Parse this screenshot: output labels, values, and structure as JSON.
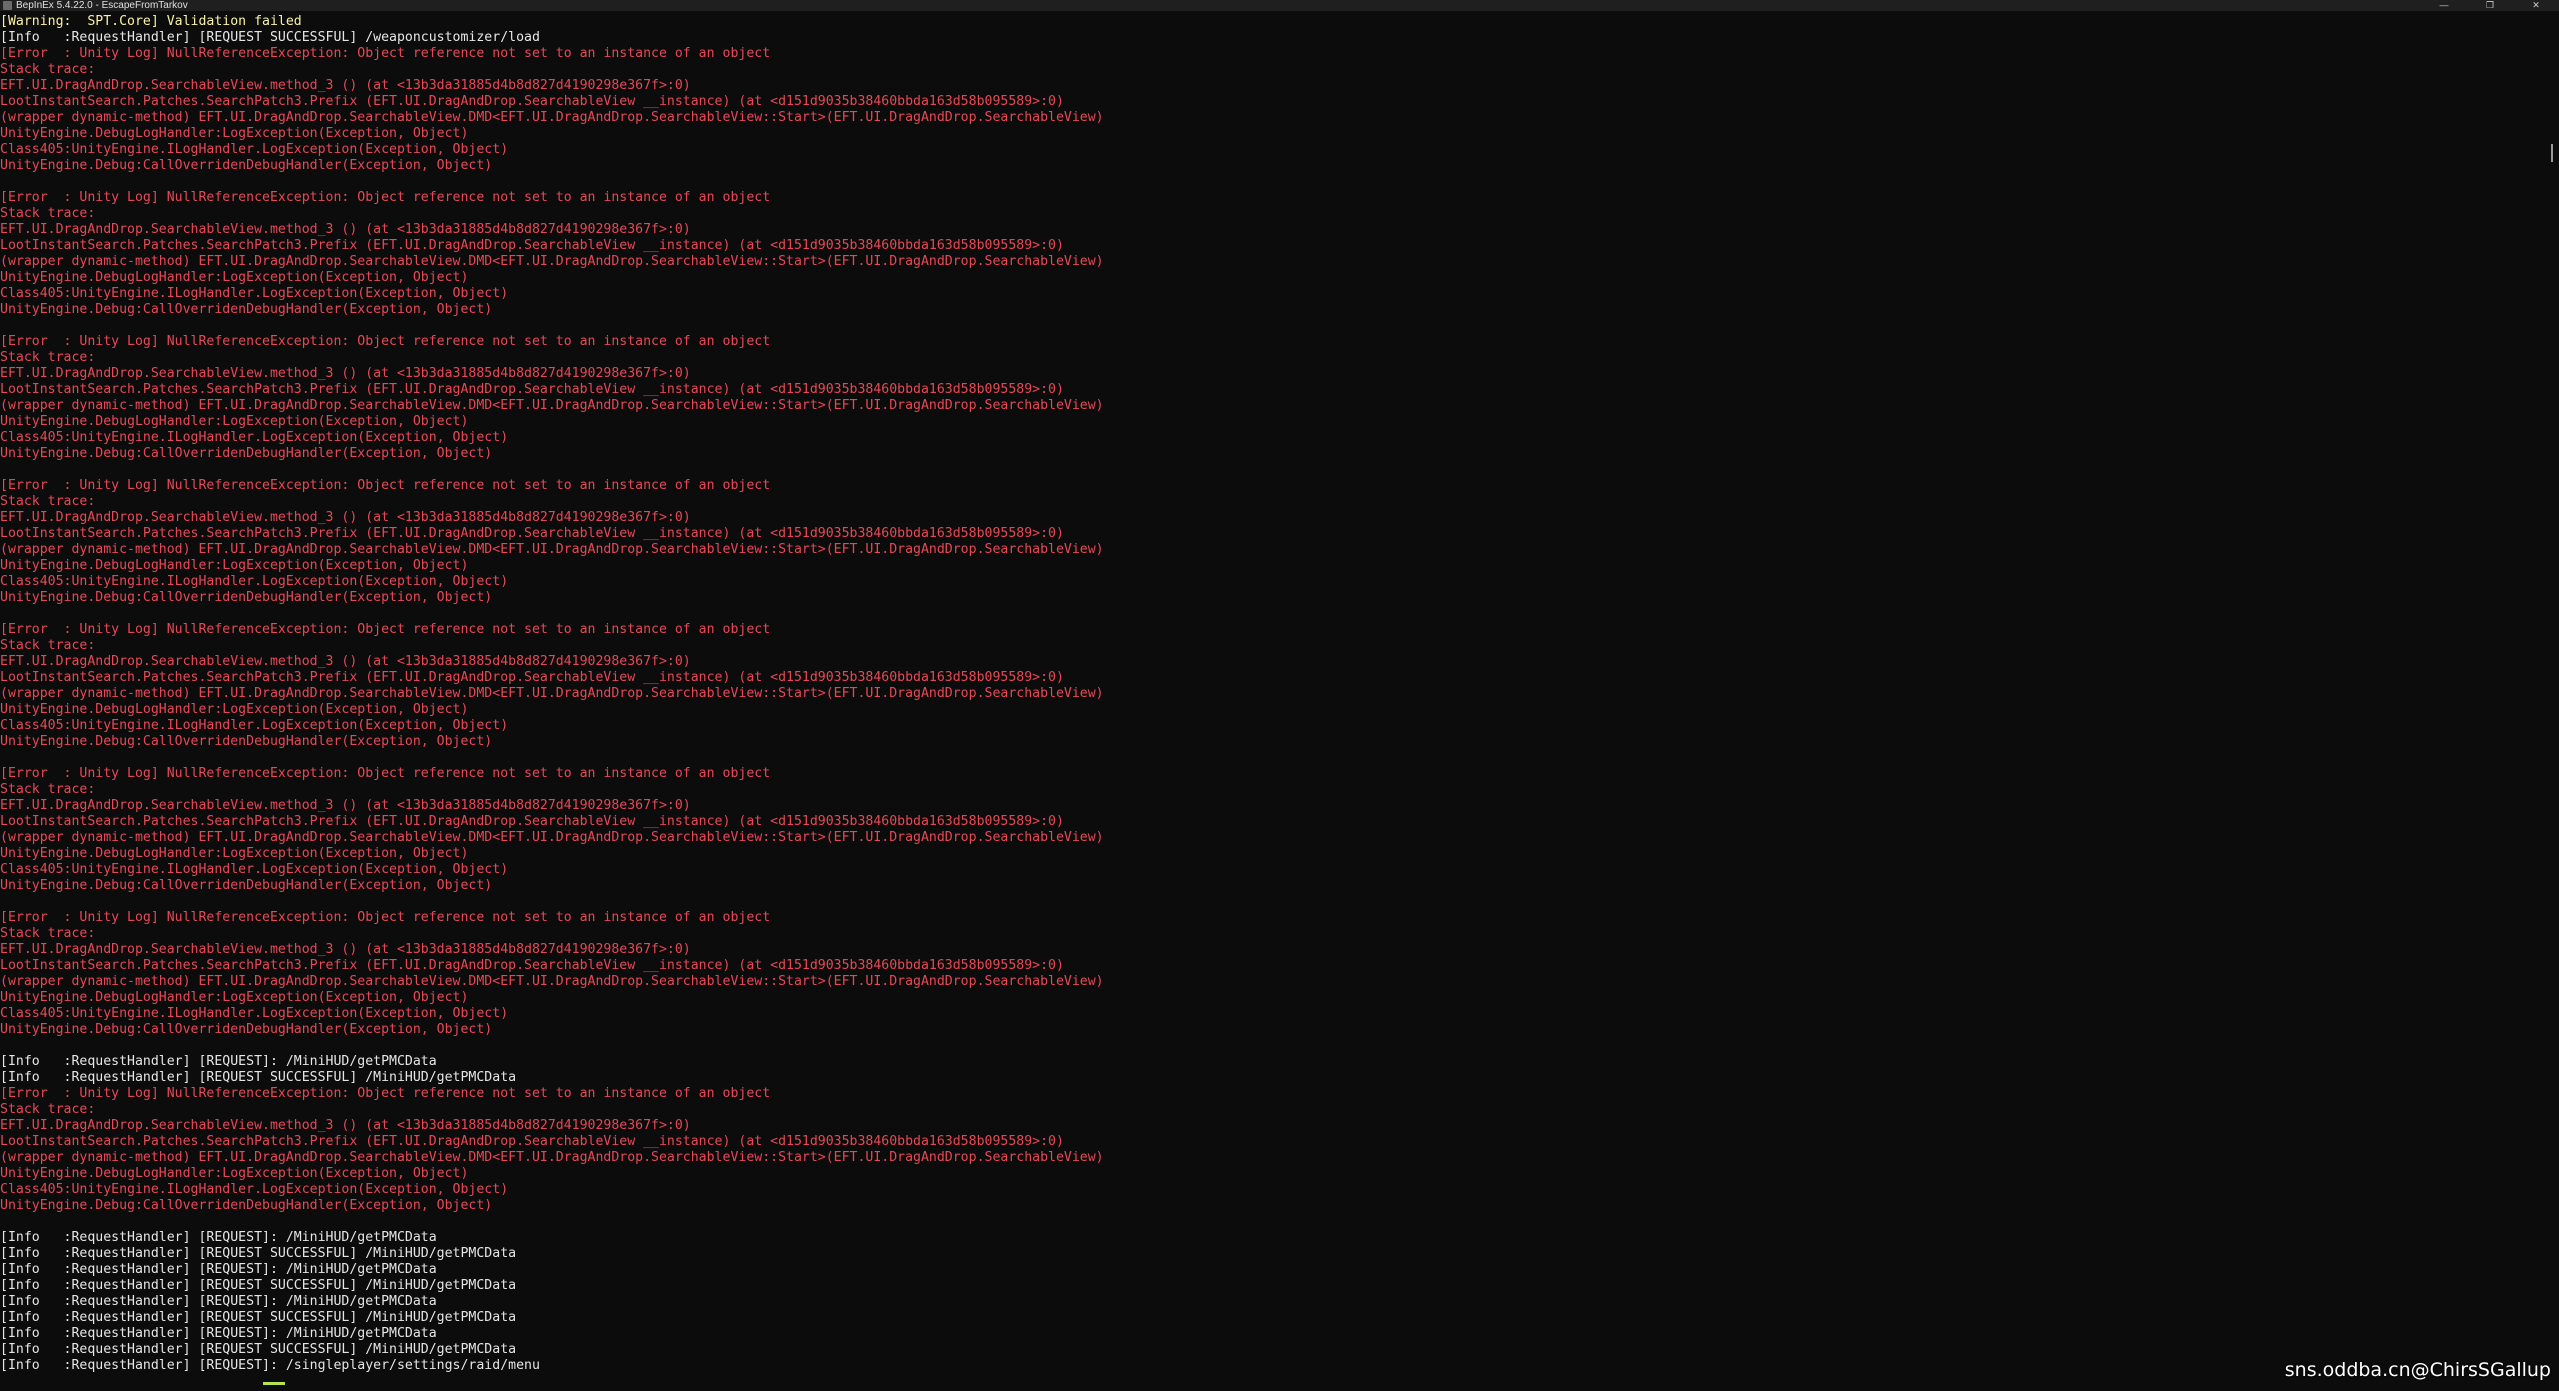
{
  "window": {
    "title": "BepInEx 5.4.22.0 - EscapeFromTarkov",
    "app_icon": "bepinex-icon",
    "minimize_glyph": "—",
    "maximize_glyph": "❐",
    "close_glyph": "✕"
  },
  "colors": {
    "background": "#0c0c0c",
    "error": "#e74856",
    "warning": "#f9f1a5",
    "info": "#e6e6e6",
    "cursor": "#b6e24e"
  },
  "console_lines": [
    {
      "type": "warning",
      "text": "[Warning:  SPT.Core] Validation failed"
    },
    {
      "type": "info",
      "text": "[Info   :RequestHandler] [REQUEST SUCCESSFUL] /weaponcustomizer/load"
    },
    {
      "type": "error",
      "text": "[Error  : Unity Log] NullReferenceException: Object reference not set to an instance of an object"
    },
    {
      "type": "error",
      "text": "Stack trace:"
    },
    {
      "type": "error",
      "text": "EFT.UI.DragAndDrop.SearchableView.method_3 () (at <13b3da31885d4b8d827d4190298e367f>:0)"
    },
    {
      "type": "error",
      "text": "LootInstantSearch.Patches.SearchPatch3.Prefix (EFT.UI.DragAndDrop.SearchableView __instance) (at <d151d9035b38460bbda163d58b095589>:0)"
    },
    {
      "type": "error",
      "text": "(wrapper dynamic-method) EFT.UI.DragAndDrop.SearchableView.DMD<EFT.UI.DragAndDrop.SearchableView::Start>(EFT.UI.DragAndDrop.SearchableView)"
    },
    {
      "type": "error",
      "text": "UnityEngine.DebugLogHandler:LogException(Exception, Object)"
    },
    {
      "type": "error",
      "text": "Class405:UnityEngine.ILogHandler.LogException(Exception, Object)"
    },
    {
      "type": "error",
      "text": "UnityEngine.Debug:CallOverridenDebugHandler(Exception, Object)"
    },
    {
      "type": "blank",
      "text": ""
    },
    {
      "type": "error",
      "text": "[Error  : Unity Log] NullReferenceException: Object reference not set to an instance of an object"
    },
    {
      "type": "error",
      "text": "Stack trace:"
    },
    {
      "type": "error",
      "text": "EFT.UI.DragAndDrop.SearchableView.method_3 () (at <13b3da31885d4b8d827d4190298e367f>:0)"
    },
    {
      "type": "error",
      "text": "LootInstantSearch.Patches.SearchPatch3.Prefix (EFT.UI.DragAndDrop.SearchableView __instance) (at <d151d9035b38460bbda163d58b095589>:0)"
    },
    {
      "type": "error",
      "text": "(wrapper dynamic-method) EFT.UI.DragAndDrop.SearchableView.DMD<EFT.UI.DragAndDrop.SearchableView::Start>(EFT.UI.DragAndDrop.SearchableView)"
    },
    {
      "type": "error",
      "text": "UnityEngine.DebugLogHandler:LogException(Exception, Object)"
    },
    {
      "type": "error",
      "text": "Class405:UnityEngine.ILogHandler.LogException(Exception, Object)"
    },
    {
      "type": "error",
      "text": "UnityEngine.Debug:CallOverridenDebugHandler(Exception, Object)"
    },
    {
      "type": "blank",
      "text": ""
    },
    {
      "type": "error",
      "text": "[Error  : Unity Log] NullReferenceException: Object reference not set to an instance of an object"
    },
    {
      "type": "error",
      "text": "Stack trace:"
    },
    {
      "type": "error",
      "text": "EFT.UI.DragAndDrop.SearchableView.method_3 () (at <13b3da31885d4b8d827d4190298e367f>:0)"
    },
    {
      "type": "error",
      "text": "LootInstantSearch.Patches.SearchPatch3.Prefix (EFT.UI.DragAndDrop.SearchableView __instance) (at <d151d9035b38460bbda163d58b095589>:0)"
    },
    {
      "type": "error",
      "text": "(wrapper dynamic-method) EFT.UI.DragAndDrop.SearchableView.DMD<EFT.UI.DragAndDrop.SearchableView::Start>(EFT.UI.DragAndDrop.SearchableView)"
    },
    {
      "type": "error",
      "text": "UnityEngine.DebugLogHandler:LogException(Exception, Object)"
    },
    {
      "type": "error",
      "text": "Class405:UnityEngine.ILogHandler.LogException(Exception, Object)"
    },
    {
      "type": "error",
      "text": "UnityEngine.Debug:CallOverridenDebugHandler(Exception, Object)"
    },
    {
      "type": "blank",
      "text": ""
    },
    {
      "type": "error",
      "text": "[Error  : Unity Log] NullReferenceException: Object reference not set to an instance of an object"
    },
    {
      "type": "error",
      "text": "Stack trace:"
    },
    {
      "type": "error",
      "text": "EFT.UI.DragAndDrop.SearchableView.method_3 () (at <13b3da31885d4b8d827d4190298e367f>:0)"
    },
    {
      "type": "error",
      "text": "LootInstantSearch.Patches.SearchPatch3.Prefix (EFT.UI.DragAndDrop.SearchableView __instance) (at <d151d9035b38460bbda163d58b095589>:0)"
    },
    {
      "type": "error",
      "text": "(wrapper dynamic-method) EFT.UI.DragAndDrop.SearchableView.DMD<EFT.UI.DragAndDrop.SearchableView::Start>(EFT.UI.DragAndDrop.SearchableView)"
    },
    {
      "type": "error",
      "text": "UnityEngine.DebugLogHandler:LogException(Exception, Object)"
    },
    {
      "type": "error",
      "text": "Class405:UnityEngine.ILogHandler.LogException(Exception, Object)"
    },
    {
      "type": "error",
      "text": "UnityEngine.Debug:CallOverridenDebugHandler(Exception, Object)"
    },
    {
      "type": "blank",
      "text": ""
    },
    {
      "type": "error",
      "text": "[Error  : Unity Log] NullReferenceException: Object reference not set to an instance of an object"
    },
    {
      "type": "error",
      "text": "Stack trace:"
    },
    {
      "type": "error",
      "text": "EFT.UI.DragAndDrop.SearchableView.method_3 () (at <13b3da31885d4b8d827d4190298e367f>:0)"
    },
    {
      "type": "error",
      "text": "LootInstantSearch.Patches.SearchPatch3.Prefix (EFT.UI.DragAndDrop.SearchableView __instance) (at <d151d9035b38460bbda163d58b095589>:0)"
    },
    {
      "type": "error",
      "text": "(wrapper dynamic-method) EFT.UI.DragAndDrop.SearchableView.DMD<EFT.UI.DragAndDrop.SearchableView::Start>(EFT.UI.DragAndDrop.SearchableView)"
    },
    {
      "type": "error",
      "text": "UnityEngine.DebugLogHandler:LogException(Exception, Object)"
    },
    {
      "type": "error",
      "text": "Class405:UnityEngine.ILogHandler.LogException(Exception, Object)"
    },
    {
      "type": "error",
      "text": "UnityEngine.Debug:CallOverridenDebugHandler(Exception, Object)"
    },
    {
      "type": "blank",
      "text": ""
    },
    {
      "type": "error",
      "text": "[Error  : Unity Log] NullReferenceException: Object reference not set to an instance of an object"
    },
    {
      "type": "error",
      "text": "Stack trace:"
    },
    {
      "type": "error",
      "text": "EFT.UI.DragAndDrop.SearchableView.method_3 () (at <13b3da31885d4b8d827d4190298e367f>:0)"
    },
    {
      "type": "error",
      "text": "LootInstantSearch.Patches.SearchPatch3.Prefix (EFT.UI.DragAndDrop.SearchableView __instance) (at <d151d9035b38460bbda163d58b095589>:0)"
    },
    {
      "type": "error",
      "text": "(wrapper dynamic-method) EFT.UI.DragAndDrop.SearchableView.DMD<EFT.UI.DragAndDrop.SearchableView::Start>(EFT.UI.DragAndDrop.SearchableView)"
    },
    {
      "type": "error",
      "text": "UnityEngine.DebugLogHandler:LogException(Exception, Object)"
    },
    {
      "type": "error",
      "text": "Class405:UnityEngine.ILogHandler.LogException(Exception, Object)"
    },
    {
      "type": "error",
      "text": "UnityEngine.Debug:CallOverridenDebugHandler(Exception, Object)"
    },
    {
      "type": "blank",
      "text": ""
    },
    {
      "type": "error",
      "text": "[Error  : Unity Log] NullReferenceException: Object reference not set to an instance of an object"
    },
    {
      "type": "error",
      "text": "Stack trace:"
    },
    {
      "type": "error",
      "text": "EFT.UI.DragAndDrop.SearchableView.method_3 () (at <13b3da31885d4b8d827d4190298e367f>:0)"
    },
    {
      "type": "error",
      "text": "LootInstantSearch.Patches.SearchPatch3.Prefix (EFT.UI.DragAndDrop.SearchableView __instance) (at <d151d9035b38460bbda163d58b095589>:0)"
    },
    {
      "type": "error",
      "text": "(wrapper dynamic-method) EFT.UI.DragAndDrop.SearchableView.DMD<EFT.UI.DragAndDrop.SearchableView::Start>(EFT.UI.DragAndDrop.SearchableView)"
    },
    {
      "type": "error",
      "text": "UnityEngine.DebugLogHandler:LogException(Exception, Object)"
    },
    {
      "type": "error",
      "text": "Class405:UnityEngine.ILogHandler.LogException(Exception, Object)"
    },
    {
      "type": "error",
      "text": "UnityEngine.Debug:CallOverridenDebugHandler(Exception, Object)"
    },
    {
      "type": "blank",
      "text": ""
    },
    {
      "type": "info",
      "text": "[Info   :RequestHandler] [REQUEST]: /MiniHUD/getPMCData"
    },
    {
      "type": "info",
      "text": "[Info   :RequestHandler] [REQUEST SUCCESSFUL] /MiniHUD/getPMCData"
    },
    {
      "type": "error",
      "text": "[Error  : Unity Log] NullReferenceException: Object reference not set to an instance of an object"
    },
    {
      "type": "error",
      "text": "Stack trace:"
    },
    {
      "type": "error",
      "text": "EFT.UI.DragAndDrop.SearchableView.method_3 () (at <13b3da31885d4b8d827d4190298e367f>:0)"
    },
    {
      "type": "error",
      "text": "LootInstantSearch.Patches.SearchPatch3.Prefix (EFT.UI.DragAndDrop.SearchableView __instance) (at <d151d9035b38460bbda163d58b095589>:0)"
    },
    {
      "type": "error",
      "text": "(wrapper dynamic-method) EFT.UI.DragAndDrop.SearchableView.DMD<EFT.UI.DragAndDrop.SearchableView::Start>(EFT.UI.DragAndDrop.SearchableView)"
    },
    {
      "type": "error",
      "text": "UnityEngine.DebugLogHandler:LogException(Exception, Object)"
    },
    {
      "type": "error",
      "text": "Class405:UnityEngine.ILogHandler.LogException(Exception, Object)"
    },
    {
      "type": "error",
      "text": "UnityEngine.Debug:CallOverridenDebugHandler(Exception, Object)"
    },
    {
      "type": "blank",
      "text": ""
    },
    {
      "type": "info",
      "text": "[Info   :RequestHandler] [REQUEST]: /MiniHUD/getPMCData"
    },
    {
      "type": "info",
      "text": "[Info   :RequestHandler] [REQUEST SUCCESSFUL] /MiniHUD/getPMCData"
    },
    {
      "type": "info",
      "text": "[Info   :RequestHandler] [REQUEST]: /MiniHUD/getPMCData"
    },
    {
      "type": "info",
      "text": "[Info   :RequestHandler] [REQUEST SUCCESSFUL] /MiniHUD/getPMCData"
    },
    {
      "type": "info",
      "text": "[Info   :RequestHandler] [REQUEST]: /MiniHUD/getPMCData"
    },
    {
      "type": "info",
      "text": "[Info   :RequestHandler] [REQUEST SUCCESSFUL] /MiniHUD/getPMCData"
    },
    {
      "type": "info",
      "text": "[Info   :RequestHandler] [REQUEST]: /MiniHUD/getPMCData"
    },
    {
      "type": "info",
      "text": "[Info   :RequestHandler] [REQUEST SUCCESSFUL] /MiniHUD/getPMCData"
    },
    {
      "type": "info",
      "text": "[Info   :RequestHandler] [REQUEST]: /singleplayer/settings/raid/menu"
    }
  ],
  "watermark": "sns.oddba.cn@ChirsSGallup"
}
